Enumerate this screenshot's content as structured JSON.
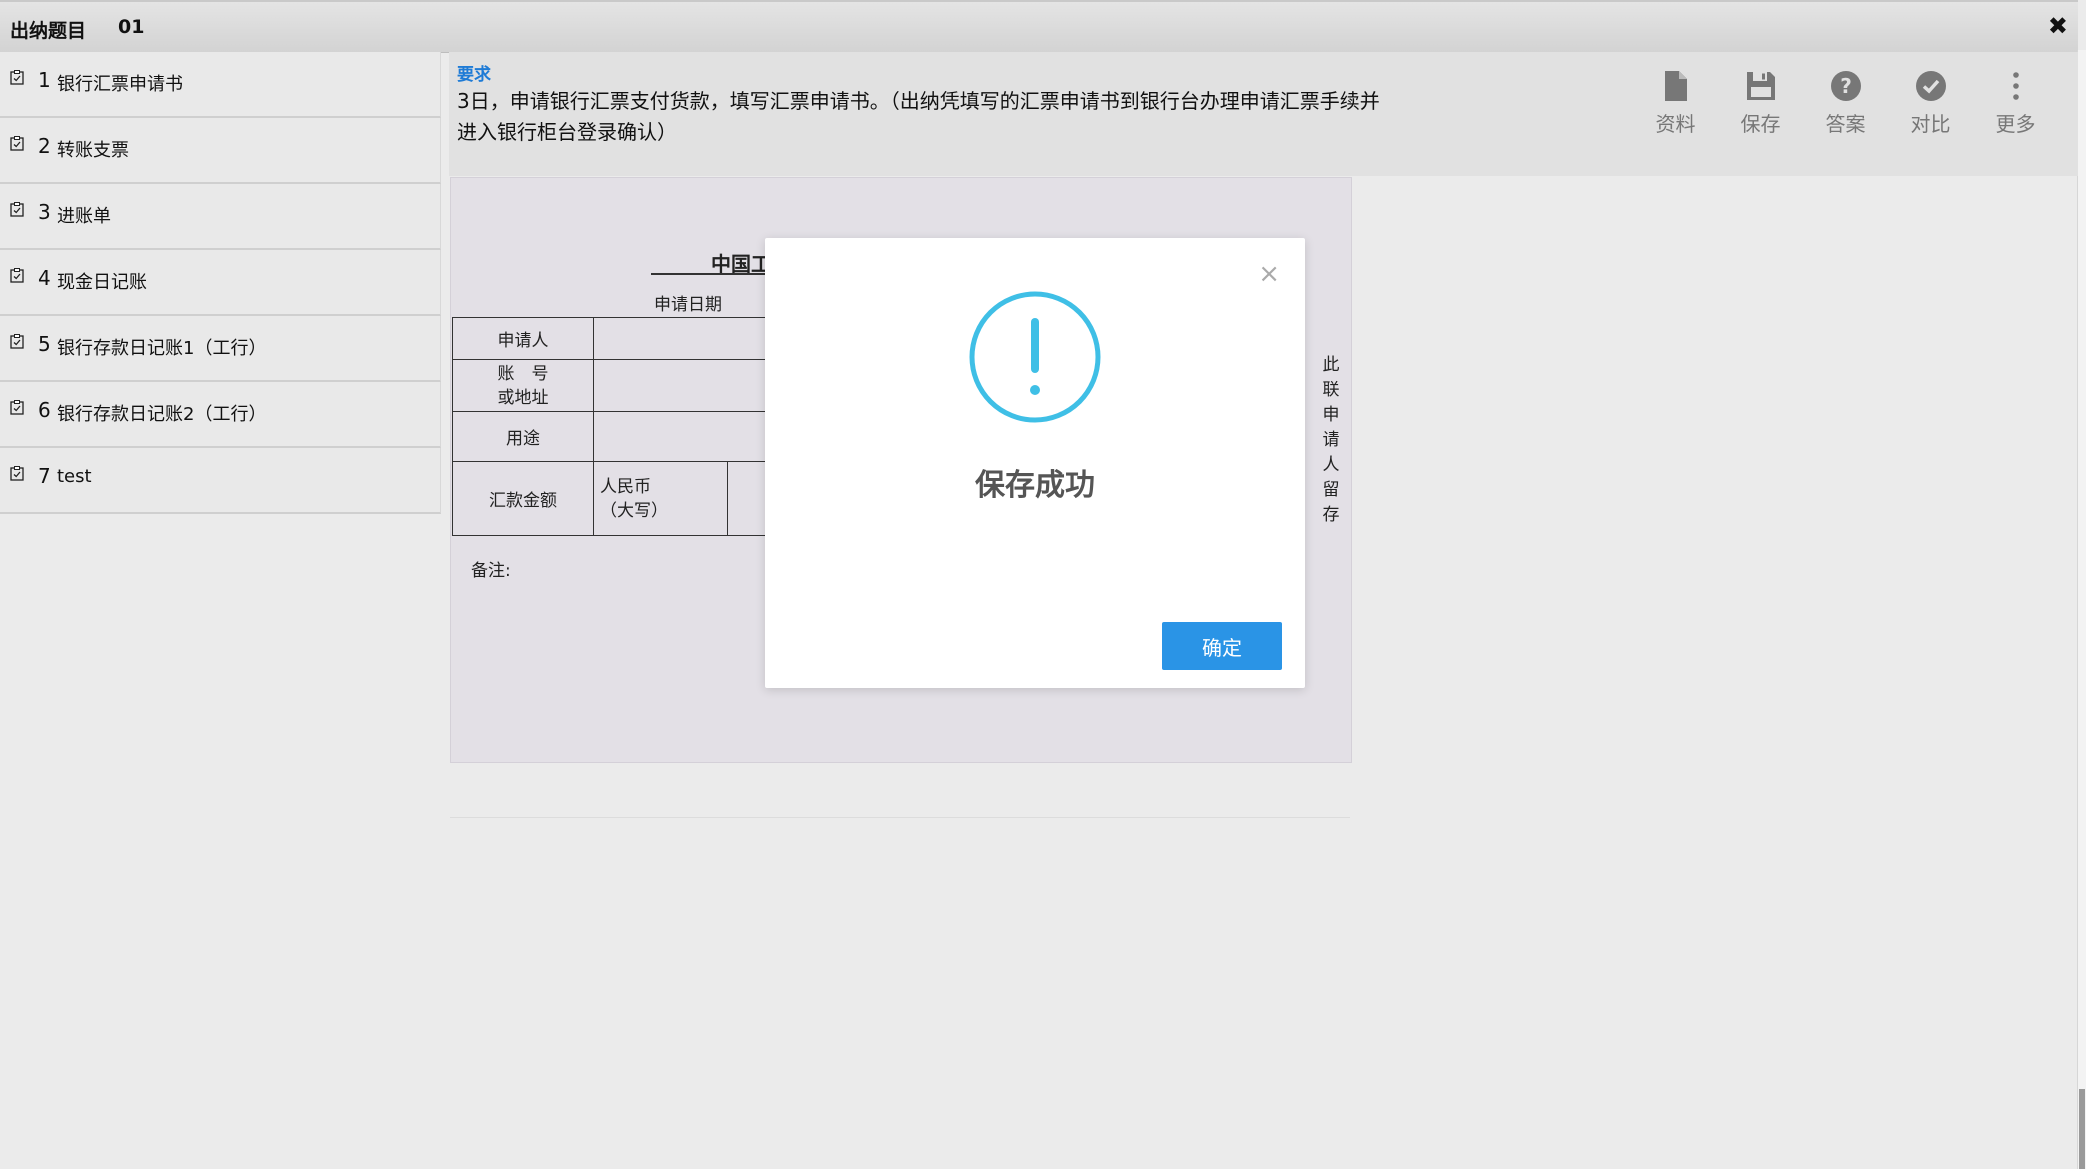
{
  "window": {
    "title": "出纳题目",
    "code": "01",
    "close_label": "✖"
  },
  "sidebar": {
    "items": [
      {
        "num": "1",
        "label": "银行汇票申请书"
      },
      {
        "num": "2",
        "label": "转账支票"
      },
      {
        "num": "3",
        "label": "进账单"
      },
      {
        "num": "4",
        "label": "现金日记账"
      },
      {
        "num": "5",
        "label": "银行存款日记账1（工行）"
      },
      {
        "num": "6",
        "label": "银行存款日记账2（工行）"
      },
      {
        "num": "7",
        "label": "test"
      }
    ]
  },
  "requirement": {
    "title": "要求",
    "text": "3日，申请银行汇票支付货款，填写汇票申请书。（出纳凭填写的汇票申请书到银行台办理申请汇票手续并进入银行柜台登录确认）"
  },
  "toolbar": {
    "items": [
      {
        "label": "资料",
        "icon": "document-icon"
      },
      {
        "label": "保存",
        "icon": "save-icon"
      },
      {
        "label": "答案",
        "icon": "question-icon"
      },
      {
        "label": "对比",
        "icon": "check-icon"
      },
      {
        "label": "更多",
        "icon": "more-vertical-icon"
      }
    ]
  },
  "document": {
    "heading": "中国工",
    "date_label": "申请日期",
    "applicant_label": "申请人",
    "account_label_1": "账　号",
    "account_label_2": "或地址",
    "purpose_label": "用途",
    "amount_label": "汇款金额",
    "rmb_label_1": "人民币",
    "rmb_label_2": "（大写）",
    "note_label": "备注:",
    "side_text": "此联申请人留存"
  },
  "modal": {
    "message": "保存成功",
    "confirm_label": "确定",
    "close_label": "×"
  },
  "colors": {
    "accent": "#2a94e6",
    "icon_ring": "#3fbfe6",
    "title_blue": "#1e7bd6"
  }
}
